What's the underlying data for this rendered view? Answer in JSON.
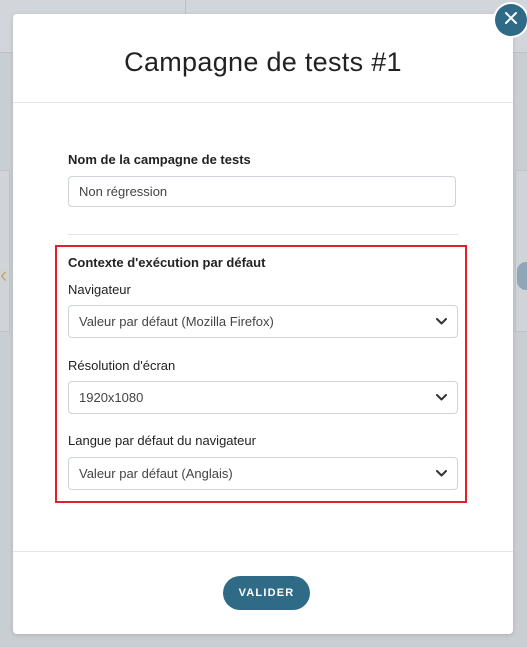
{
  "modal": {
    "title": "Campagne de tests #1"
  },
  "campaign_name": {
    "label": "Nom de la campagne de tests",
    "value": "Non régression"
  },
  "execution_context": {
    "heading": "Contexte d'exécution par défaut",
    "browser": {
      "label": "Navigateur",
      "selected": "Valeur par défaut (Mozilla Firefox)"
    },
    "resolution": {
      "label": "Résolution d'écran",
      "selected": "1920x1080"
    },
    "language": {
      "label": "Langue par défaut du navigateur",
      "selected": "Valeur par défaut (Anglais)"
    }
  },
  "actions": {
    "submit_label": "VALIDER"
  },
  "icons": {
    "close": "close-icon",
    "select_arrow": "chevron-down-icon"
  },
  "colors": {
    "primary": "#2f6b87",
    "highlight_border": "#e0202a",
    "overlay": "#c9ced3"
  }
}
